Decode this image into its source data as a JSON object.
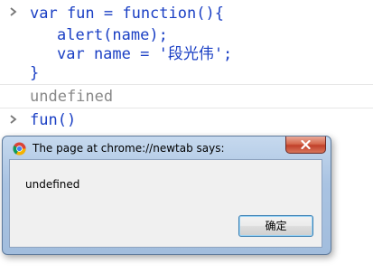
{
  "console": {
    "entries": [
      {
        "type": "input",
        "lines": [
          "var fun = function(){",
          "alert(name);",
          "var name = '段光伟';",
          "}"
        ]
      },
      {
        "type": "output",
        "text": "undefined"
      },
      {
        "type": "input",
        "lines": [
          "fun()"
        ]
      }
    ]
  },
  "dialog": {
    "title": "The page at chrome://newtab says:",
    "message": "undefined",
    "ok_label": "确定",
    "icon": "chrome-logo-icon"
  },
  "colors": {
    "code": "#1a3fc4",
    "output": "#888888",
    "prompt": "#777777",
    "dialog_frame": "#a9c3e2",
    "close_button": "#c1402a"
  }
}
